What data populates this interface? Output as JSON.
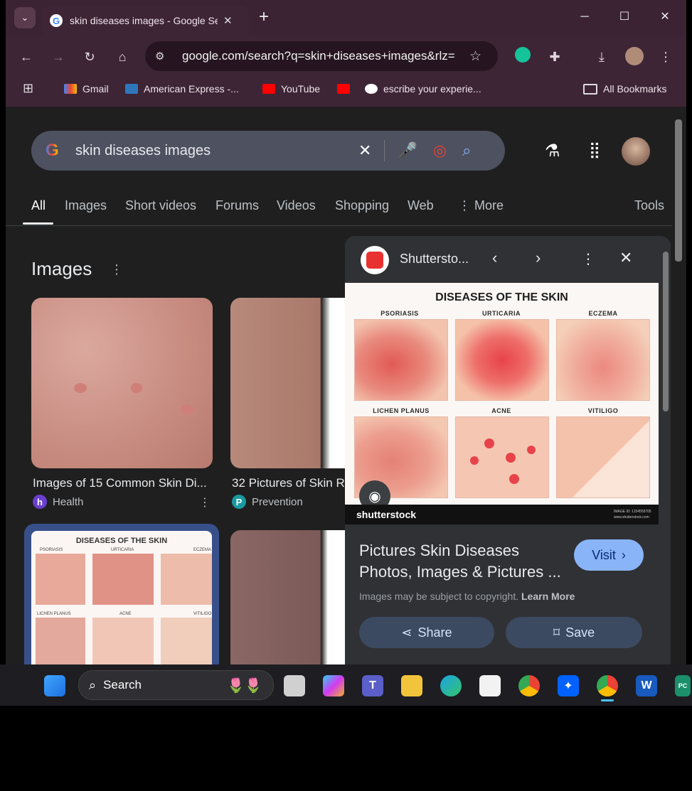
{
  "browser": {
    "tab_title": "skin diseases images - Google Search",
    "tab_close": "✕",
    "new_tab": "+",
    "url": "google.com/search?q=skin+diseases+images&rlz=",
    "bookmarks": [
      {
        "label": "Gmail"
      },
      {
        "label": "American Express -..."
      },
      {
        "label": "YouTube"
      },
      {
        "label": ""
      },
      {
        "label": "escribe your experie..."
      }
    ],
    "all_bookmarks": "All Bookmarks"
  },
  "search": {
    "query": "skin diseases images",
    "tabs": [
      "All",
      "Images",
      "Short videos",
      "Forums",
      "Videos",
      "Shopping",
      "Web",
      "More"
    ],
    "tools": "Tools"
  },
  "images_section": {
    "heading": "Images",
    "results": [
      {
        "caption": "Images of 15 Common Skin Di...",
        "source": "Health",
        "source_letter": "h",
        "color": "#6b3fd1"
      },
      {
        "caption": "32 Pictures of Skin R",
        "source": "Prevention",
        "source_letter": "P",
        "color": "#1a9aa0"
      }
    ]
  },
  "panel": {
    "site": "Shuttersto...",
    "image_title": "DISEASES OF THE SKIN",
    "grid_labels": [
      "PSORIASIS",
      "URTICARIA",
      "ECZEMA",
      "LICHEN PLANUS",
      "ACNE",
      "VITILIGO"
    ],
    "watermark": "shutterstock",
    "image_id": "IMAGE ID: 1154555705",
    "image_site": "www.shutterstock.com",
    "title": "Pictures Skin Diseases Photos, Images & Pictures ...",
    "visit": "Visit",
    "copyright": "Images may be subject to copyright.",
    "learn_more": "Learn More",
    "share": "Share",
    "save": "Save"
  },
  "thumb2": {
    "title": "DISEASES OF THE SKIN",
    "labels": [
      "PSORIASIS",
      "URTICARIA",
      "ECZEMA",
      "LICHEN PLANUS",
      "ACNE",
      "VITILIGO"
    ]
  },
  "taskbar": {
    "search": "Search"
  }
}
